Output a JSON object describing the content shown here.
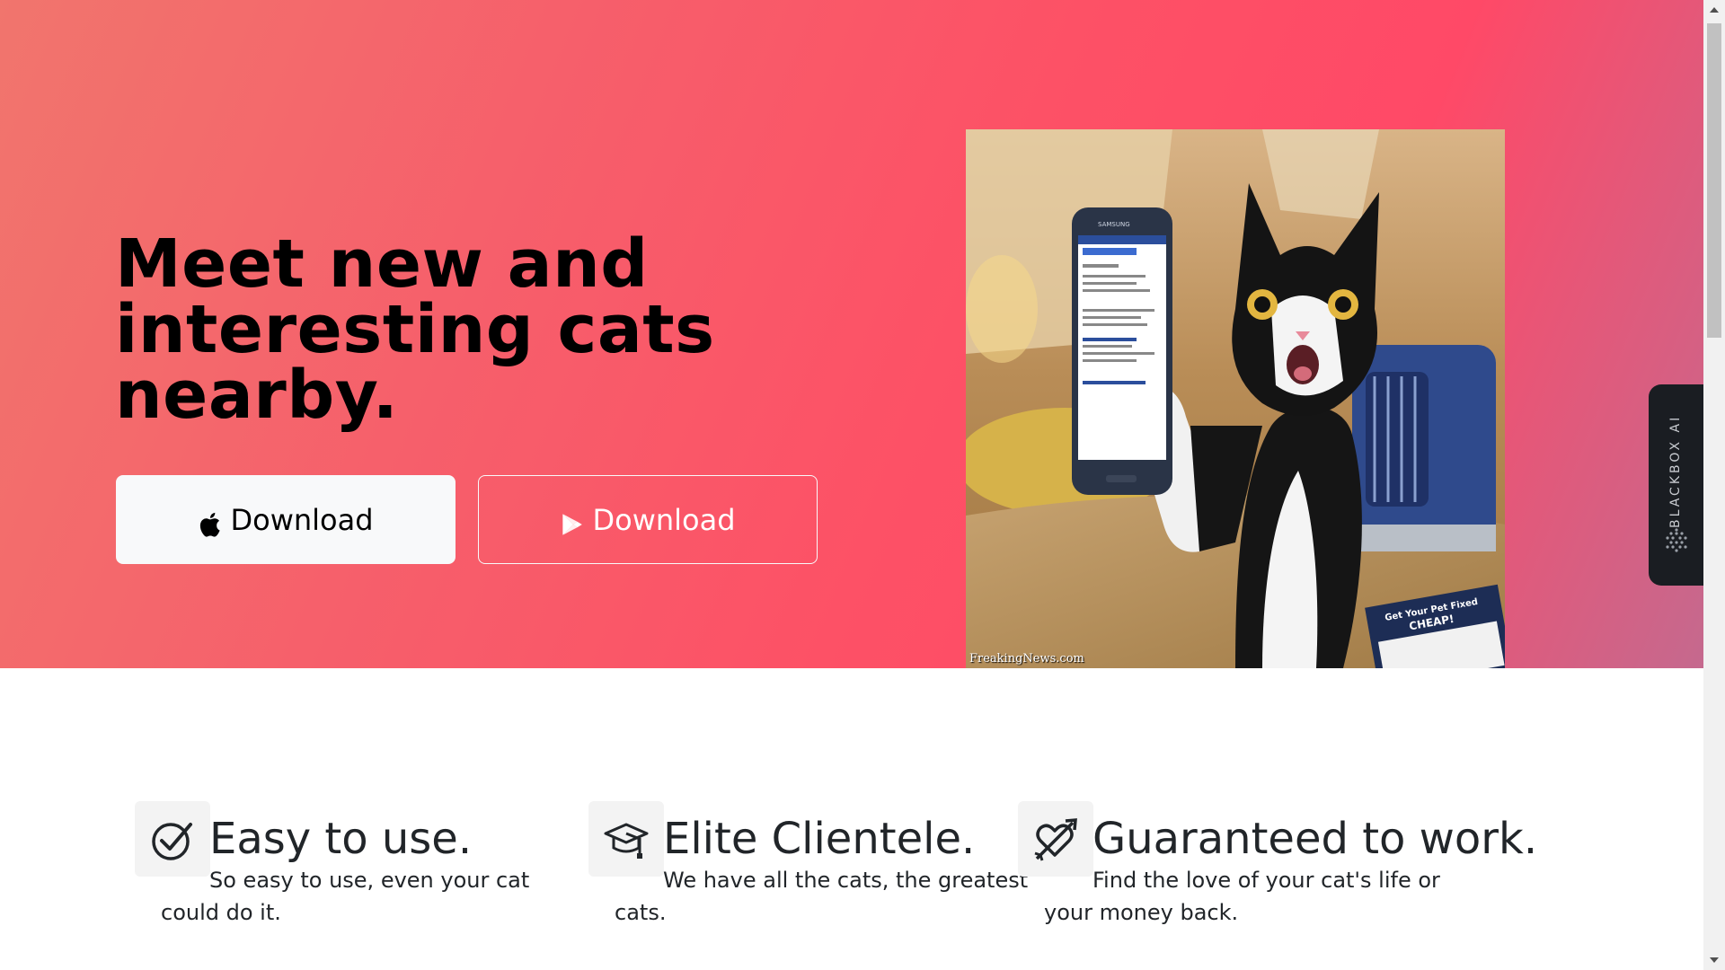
{
  "hero": {
    "headline": "Meet new and interesting cats nearby.",
    "buttons": {
      "apple_label": "Download",
      "play_label": "Download"
    },
    "image": {
      "alt": "Cat holding a smartphone",
      "watermark": "FreakingNews.com",
      "phone_brand": "SAMSUNG",
      "flyer_text": "Get Your Pet Fixed CHEAP!"
    }
  },
  "side_widget": {
    "label": "BLACKBOX AI"
  },
  "features": [
    {
      "icon": "check-circle-icon",
      "title": "Easy to use.",
      "description": "So easy to use, even your cat could do it."
    },
    {
      "icon": "graduation-cap-icon",
      "title": "Elite Clientele.",
      "description": "We have all the cats, the greatest cats."
    },
    {
      "icon": "heart-arrow-icon",
      "title": "Guaranteed to work.",
      "description": "Find the love of your cat's life or your money back."
    }
  ],
  "colors": {
    "hero_gradient_start": "#f1756d",
    "hero_gradient_mid": "#ff4967",
    "hero_gradient_end": "#c5698e",
    "button_light": "#f8f9fa",
    "text_dark": "#212529"
  }
}
